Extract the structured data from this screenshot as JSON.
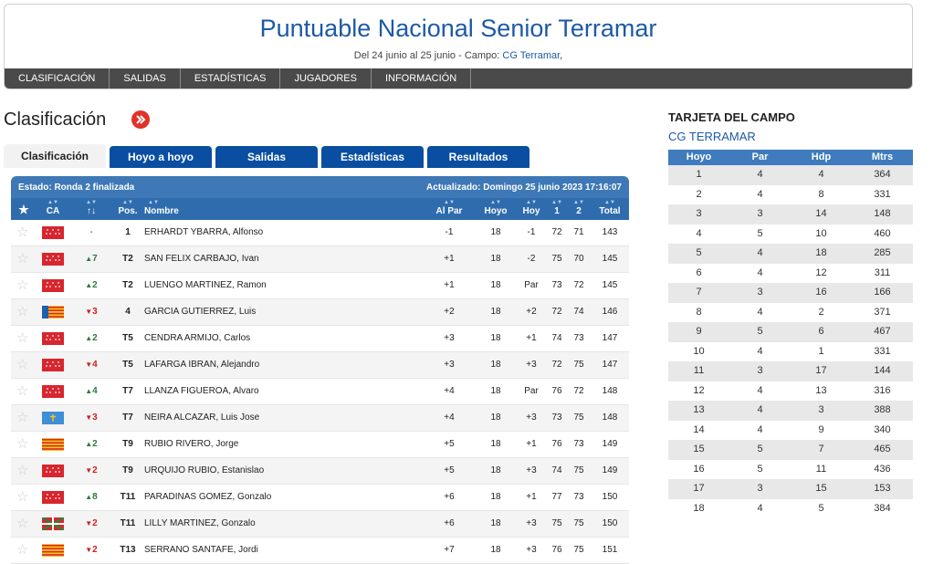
{
  "header": {
    "title": "Puntuable Nacional Senior Terramar",
    "subtitle_prefix": "Del 24 junio al 25 junio - Campo: ",
    "subtitle_link": "CG Terramar",
    "subtitle_suffix": ","
  },
  "menu": [
    "CLASIFICACIÓN",
    "SALIDAS",
    "ESTADÍSTICAS",
    "JUGADORES",
    "INFORMACIÓN"
  ],
  "section_title": "Clasificación",
  "tabs": [
    "Clasificación",
    "Hoyo a hoyo",
    "Salidas",
    "Estadísticas",
    "Resultados"
  ],
  "board": {
    "estado": "Estado: Ronda 2 finalizada",
    "actualizado": "Actualizado: Domingo 25 junio 2023 17:16:07",
    "columns": [
      "CA",
      "Pos.",
      "Nombre",
      "Al Par",
      "Hoyo",
      "Hoy",
      "1",
      "2",
      "Total"
    ],
    "rows": [
      {
        "flag": "madrid",
        "mv": "-",
        "dir": "none",
        "pos": "1",
        "name": "ERHARDT YBARRA, Alfonso",
        "alpar": "-1",
        "hoyo": "18",
        "hoy": "-1",
        "r1": "72",
        "r2": "71",
        "tot": "143"
      },
      {
        "flag": "madrid",
        "mv": "7",
        "dir": "up",
        "pos": "T2",
        "name": "SAN FELIX CARBAJO, Ivan",
        "alpar": "+1",
        "hoyo": "18",
        "hoy": "-2",
        "r1": "75",
        "r2": "70",
        "tot": "145"
      },
      {
        "flag": "madrid",
        "mv": "2",
        "dir": "up",
        "pos": "T2",
        "name": "LUENGO MARTINEZ, Ramon",
        "alpar": "+1",
        "hoyo": "18",
        "hoy": "Par",
        "r1": "73",
        "r2": "72",
        "tot": "145"
      },
      {
        "flag": "valencia",
        "mv": "3",
        "dir": "down",
        "pos": "4",
        "name": "GARCIA GUTIERREZ, Luis",
        "alpar": "+2",
        "hoyo": "18",
        "hoy": "+2",
        "r1": "72",
        "r2": "74",
        "tot": "146"
      },
      {
        "flag": "madrid",
        "mv": "2",
        "dir": "up",
        "pos": "T5",
        "name": "CENDRA ARMIJO, Carlos",
        "alpar": "+3",
        "hoyo": "18",
        "hoy": "+1",
        "r1": "74",
        "r2": "73",
        "tot": "147"
      },
      {
        "flag": "madrid",
        "mv": "4",
        "dir": "down",
        "pos": "T5",
        "name": "LAFARGA IBRAN, Alejandro",
        "alpar": "+3",
        "hoyo": "18",
        "hoy": "+3",
        "r1": "72",
        "r2": "75",
        "tot": "147"
      },
      {
        "flag": "madrid",
        "mv": "4",
        "dir": "up",
        "pos": "T7",
        "name": "LLANZA FIGUEROA, Alvaro",
        "alpar": "+4",
        "hoyo": "18",
        "hoy": "Par",
        "r1": "76",
        "r2": "72",
        "tot": "148"
      },
      {
        "flag": "asturias",
        "mv": "3",
        "dir": "down",
        "pos": "T7",
        "name": "NEIRA ALCAZAR, Luis Jose",
        "alpar": "+4",
        "hoyo": "18",
        "hoy": "+3",
        "r1": "73",
        "r2": "75",
        "tot": "148"
      },
      {
        "flag": "cataluna",
        "mv": "2",
        "dir": "up",
        "pos": "T9",
        "name": "RUBIO RIVERO, Jorge",
        "alpar": "+5",
        "hoyo": "18",
        "hoy": "+1",
        "r1": "76",
        "r2": "73",
        "tot": "149"
      },
      {
        "flag": "madrid",
        "mv": "2",
        "dir": "down",
        "pos": "T9",
        "name": "URQUIJO RUBIO, Estanislao",
        "alpar": "+5",
        "hoyo": "18",
        "hoy": "+3",
        "r1": "74",
        "r2": "75",
        "tot": "149"
      },
      {
        "flag": "madrid",
        "mv": "8",
        "dir": "up",
        "pos": "T11",
        "name": "PARADINAS GOMEZ, Gonzalo",
        "alpar": "+6",
        "hoyo": "18",
        "hoy": "+1",
        "r1": "77",
        "r2": "73",
        "tot": "150"
      },
      {
        "flag": "euskadi",
        "mv": "2",
        "dir": "down",
        "pos": "T11",
        "name": "LILLY MARTINEZ, Gonzalo",
        "alpar": "+6",
        "hoyo": "18",
        "hoy": "+3",
        "r1": "75",
        "r2": "75",
        "tot": "150"
      },
      {
        "flag": "cataluna",
        "mv": "2",
        "dir": "down",
        "pos": "T13",
        "name": "SERRANO SANTAFE, Jordi",
        "alpar": "+7",
        "hoyo": "18",
        "hoy": "+3",
        "r1": "76",
        "r2": "75",
        "tot": "151"
      }
    ]
  },
  "card": {
    "title": "TARJETA DEL CAMPO",
    "subtitle": "CG TERRAMAR",
    "columns": [
      "Hoyo",
      "Par",
      "Hdp",
      "Mtrs"
    ],
    "rows": [
      [
        "1",
        "4",
        "4",
        "364"
      ],
      [
        "2",
        "4",
        "8",
        "331"
      ],
      [
        "3",
        "3",
        "14",
        "148"
      ],
      [
        "4",
        "5",
        "10",
        "460"
      ],
      [
        "5",
        "4",
        "18",
        "285"
      ],
      [
        "6",
        "4",
        "12",
        "311"
      ],
      [
        "7",
        "3",
        "16",
        "166"
      ],
      [
        "8",
        "4",
        "2",
        "371"
      ],
      [
        "9",
        "5",
        "6",
        "467"
      ],
      [
        "10",
        "4",
        "1",
        "331"
      ],
      [
        "11",
        "3",
        "17",
        "144"
      ],
      [
        "12",
        "4",
        "13",
        "316"
      ],
      [
        "13",
        "4",
        "3",
        "388"
      ],
      [
        "14",
        "4",
        "9",
        "340"
      ],
      [
        "15",
        "5",
        "7",
        "465"
      ],
      [
        "16",
        "5",
        "11",
        "436"
      ],
      [
        "17",
        "3",
        "15",
        "153"
      ],
      [
        "18",
        "4",
        "5",
        "384"
      ]
    ]
  },
  "colors": {
    "brand_blue": "#0a4ea2",
    "header_blue": "#3e78b6",
    "menu_dark": "#4a4a4a",
    "up_green": "#2c7a3a",
    "down_red": "#d11f1f"
  }
}
